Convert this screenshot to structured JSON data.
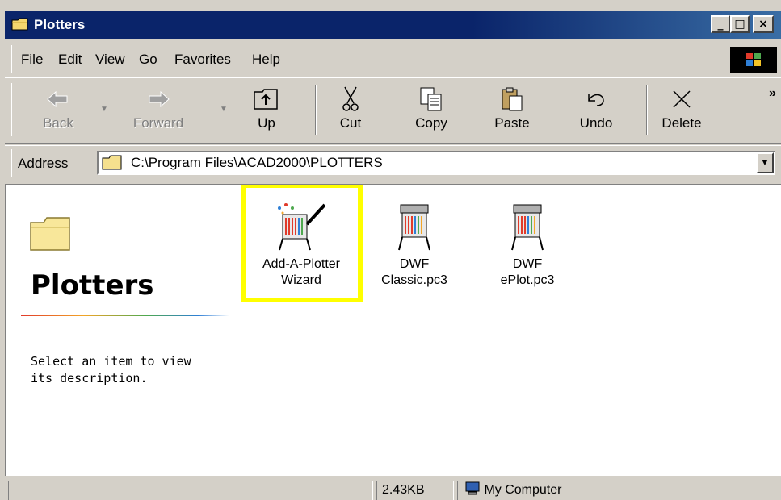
{
  "window": {
    "title": "Plotters",
    "controls": [
      "minimize",
      "maximize",
      "close"
    ]
  },
  "menu": {
    "items": [
      {
        "label": "File",
        "accel": "F"
      },
      {
        "label": "Edit",
        "accel": "E"
      },
      {
        "label": "View",
        "accel": "V"
      },
      {
        "label": "Go",
        "accel": "G"
      },
      {
        "label": "Favorites",
        "accel": "a"
      },
      {
        "label": "Help",
        "accel": "H"
      }
    ]
  },
  "toolbar": {
    "back_label": "Back",
    "forward_label": "Forward",
    "up_label": "Up",
    "cut_label": "Cut",
    "copy_label": "Copy",
    "paste_label": "Paste",
    "undo_label": "Undo",
    "delete_label": "Delete",
    "more_label": "»"
  },
  "address": {
    "label": "Address",
    "value": "C:\\Program Files\\ACAD2000\\PLOTTERS"
  },
  "left_pane": {
    "title": "Plotters",
    "description": "Select an item to view its description."
  },
  "files": [
    {
      "name_line1": "Add-A-Plotter",
      "name_line2": "Wizard",
      "icon": "wizard-plotter-icon",
      "highlighted": true
    },
    {
      "name_line1": "DWF",
      "name_line2": "Classic.pc3",
      "icon": "plotter-icon",
      "highlighted": false
    },
    {
      "name_line1": "DWF",
      "name_line2": "ePlot.pc3",
      "icon": "plotter-icon",
      "highlighted": false
    }
  ],
  "status": {
    "size": "2.43KB",
    "zone": "My Computer"
  },
  "colors": {
    "titlebar": "#0a246a",
    "face": "#d4d0c8",
    "highlight_box": "#ffff00"
  }
}
